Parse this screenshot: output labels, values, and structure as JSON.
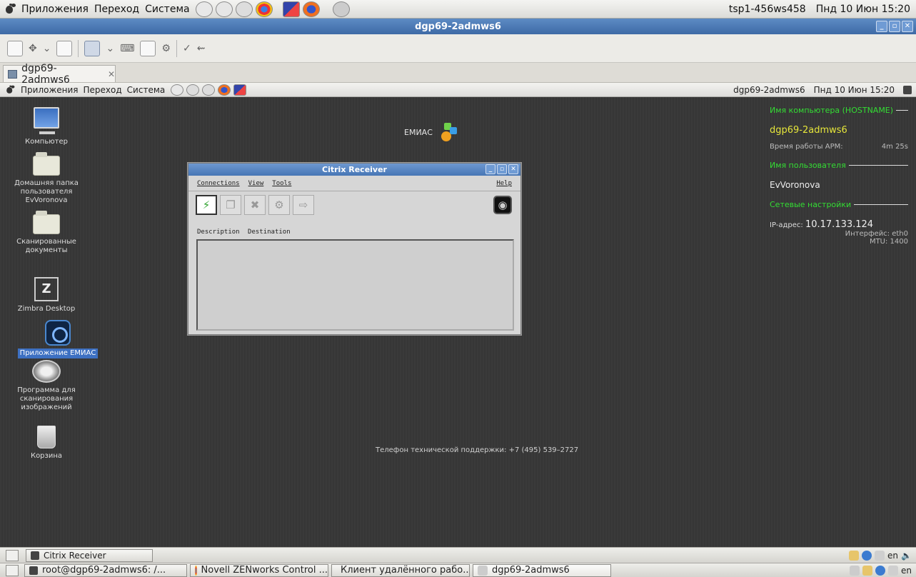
{
  "host_panel": {
    "menu": [
      "Приложения",
      "Переход",
      "Система"
    ],
    "hostname": "tsp1-456ws458",
    "datetime": "Пнд 10 Июн 15:20"
  },
  "host_window": {
    "title": "dgp69-2admws6",
    "tab_label": "dgp69-2admws6"
  },
  "remote_panel": {
    "menu": [
      "Приложения",
      "Переход",
      "Система"
    ],
    "hostname": "dgp69-2admws6",
    "datetime": "Пнд 10 Июн 15:20"
  },
  "desktop_icons": [
    {
      "label": "Компьютер",
      "icon": "computer-icon"
    },
    {
      "label": "Домашняя папка пользователя EvVoronova",
      "icon": "home-folder-icon"
    },
    {
      "label": "Сканированные документы",
      "icon": "folder-icon"
    },
    {
      "label": "Zimbra Desktop",
      "icon": "zimbra-icon"
    },
    {
      "label": "Приложение ЕМИАС",
      "icon": "emias-app-icon"
    },
    {
      "label": "Программа для сканирования изображений",
      "icon": "scanner-icon"
    },
    {
      "label": "Корзина",
      "icon": "trash-icon"
    }
  ],
  "logo": {
    "text": "ЕМИАС"
  },
  "info_panel": {
    "hostname_label": "Имя компьютера (HOSTNAME)",
    "hostname": "dgp69-2admws6",
    "uptime_label": "Время работы АРМ:",
    "uptime": "4m 25s",
    "user_label": "Имя пользователя",
    "user": "EvVoronova",
    "net_label": "Сетевые настройки",
    "ip_label": "IP-адрес:",
    "ip": "10.17.133.124",
    "iface": "Интерфейс:  eth0",
    "mtu": "MTU: 1400"
  },
  "support_text": "Телефон технической поддержки: +7 (495) 539–2727",
  "citrix": {
    "title": "Citrix Receiver",
    "menu": [
      "Connections",
      "View",
      "Tools"
    ],
    "help": "Help",
    "columns": [
      "Description",
      "Destination"
    ]
  },
  "remote_taskbar": {
    "task": "Citrix Receiver",
    "lang": "en"
  },
  "host_taskbar": {
    "tasks": [
      "root@dgp69-2admws6: /...",
      "Novell ZENworks Control ...",
      "Клиент удалённого рабо...",
      "dgp69-2admws6"
    ],
    "lang": "en"
  }
}
